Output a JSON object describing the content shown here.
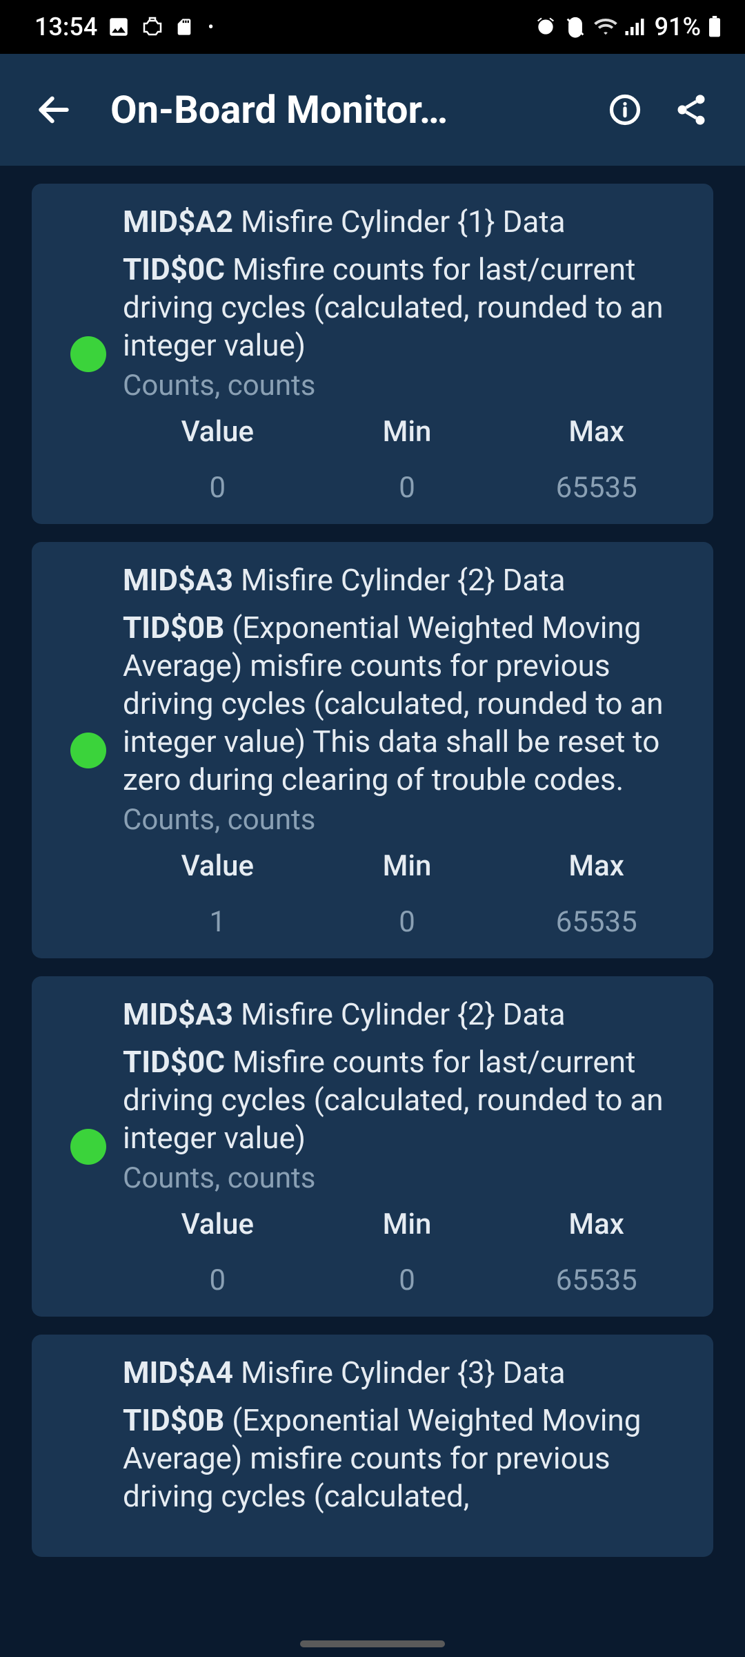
{
  "status": {
    "time": "13:54",
    "battery": "91%"
  },
  "appbar": {
    "title": "On-Board Monitor…"
  },
  "labels": {
    "value": "Value",
    "min": "Min",
    "max": "Max",
    "units": "Counts, counts"
  },
  "cards": [
    {
      "mid_code": "MID$A2",
      "mid_text": "Misfire Cylinder {1} Data",
      "tid_code": "TID$0C",
      "tid_text": "Misfire counts for last/current driving cycles (calculated, rounded to an integer value)",
      "value": "0",
      "min": "0",
      "max": "65535"
    },
    {
      "mid_code": "MID$A3",
      "mid_text": "Misfire Cylinder {2} Data",
      "tid_code": "TID$0B",
      "tid_text": "(Exponential Weighted Moving Average) misfire counts for previous driving cycles (calculated, rounded to an integer value) This data shall be reset to zero during clearing of trouble codes.",
      "value": "1",
      "min": "0",
      "max": "65535"
    },
    {
      "mid_code": "MID$A3",
      "mid_text": "Misfire Cylinder {2} Data",
      "tid_code": "TID$0C",
      "tid_text": "Misfire counts for last/current driving cycles (calculated, rounded to an integer value)",
      "value": "0",
      "min": "0",
      "max": "65535"
    },
    {
      "mid_code": "MID$A4",
      "mid_text": "Misfire Cylinder {3} Data",
      "tid_code": "TID$0B",
      "tid_text": "(Exponential Weighted Moving Average) misfire counts for previous driving cycles (calculated,",
      "value": "",
      "min": "",
      "max": ""
    }
  ]
}
